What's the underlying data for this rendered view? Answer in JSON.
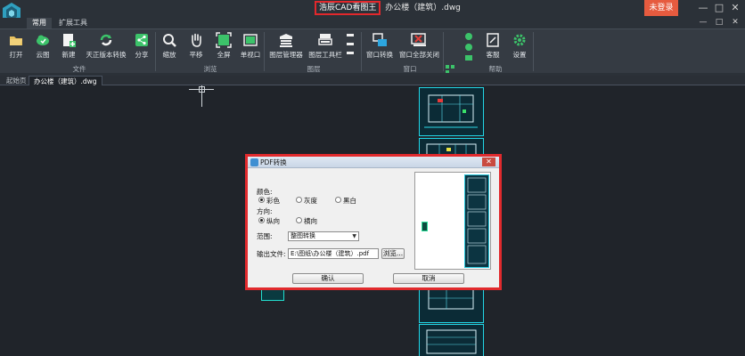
{
  "titlebar": {
    "brand": "浩辰CAD看图王",
    "file": "办公楼（建筑）.dwg",
    "login": "未登录",
    "controls": [
      "—",
      "□",
      "✕"
    ],
    "sub_controls": [
      "—",
      "□",
      "✕"
    ]
  },
  "menu_tabs": [
    "常用",
    "扩展工具"
  ],
  "ribbon": {
    "buttons": [
      {
        "label": "打开",
        "icon": "open-folder-icon"
      },
      {
        "label": "云图",
        "icon": "cloud-icon"
      },
      {
        "label": "新建",
        "icon": "new-file-icon"
      },
      {
        "label": "天正版本转换",
        "icon": "convert-icon"
      },
      {
        "label": "分享",
        "icon": "share-icon"
      },
      {
        "label": "缩放",
        "icon": "zoom-icon"
      },
      {
        "label": "平移",
        "icon": "pan-hand-icon"
      },
      {
        "label": "全屏",
        "icon": "fullscreen-icon"
      },
      {
        "label": "单视口",
        "icon": "single-viewport-icon"
      },
      {
        "label": "图层管理器",
        "icon": "layer-manager-icon"
      },
      {
        "label": "图层工具栏",
        "icon": "layer-toolbar-icon"
      },
      {
        "label": "窗口转换",
        "icon": "window-switch-icon"
      },
      {
        "label": "窗口全部关闭",
        "icon": "close-all-windows-icon"
      },
      {
        "label": "客服",
        "icon": "customer-service-icon"
      },
      {
        "label": "设置",
        "icon": "settings-icon"
      }
    ],
    "groups": [
      "文件",
      "浏览",
      "图层",
      "窗口",
      "帮助"
    ]
  },
  "doc_tabs": {
    "start": "起始页",
    "active": "办公楼（建筑）.dwg"
  },
  "dialog": {
    "title": "PDF转换",
    "color_label": "颜色:",
    "color_options": [
      "彩色",
      "灰度",
      "黑白"
    ],
    "direction_label": "方向:",
    "direction_options": [
      "纵向",
      "横向"
    ],
    "range_label": "范围:",
    "range_value": "整图转换",
    "output_label": "输出文件:",
    "output_path": "E:\\图纸\\办公楼（建筑）.pdf",
    "browse": "浏览...",
    "ok": "确认",
    "cancel": "取消"
  },
  "colors": {
    "accent_red": "#e12a2d",
    "login_orange": "#e65b3f",
    "drawing_cyan": "#22d6e6"
  }
}
